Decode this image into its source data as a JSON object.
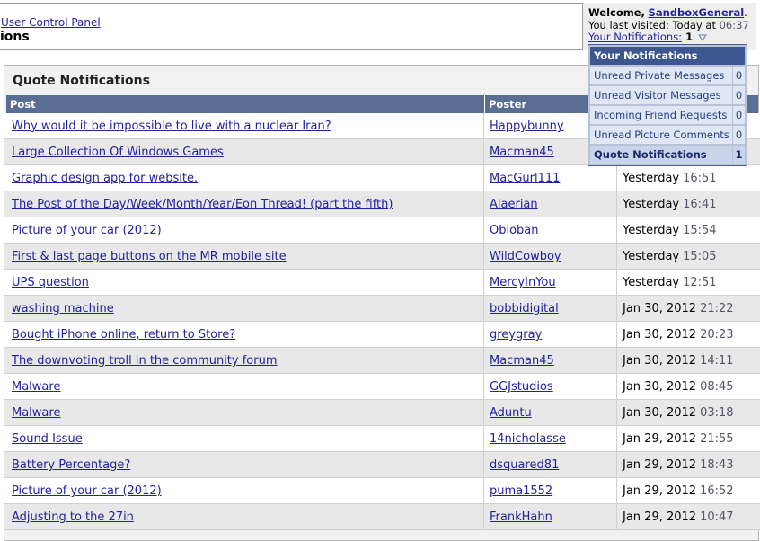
{
  "breadcrumb": "User Control Panel",
  "page_title": "ions",
  "welcome": {
    "label": "Welcome,",
    "username": "SandboxGeneral",
    "period": ".",
    "last_visited_label": "You last visited: Today at",
    "last_visited_time": "06:37",
    "notifications_label": "Your Notifications:",
    "notifications_count": "1"
  },
  "dropdown": {
    "title": "Your Notifications",
    "items": [
      {
        "label": "Unread Private Messages",
        "count": "0"
      },
      {
        "label": "Unread Visitor Messages",
        "count": "0"
      },
      {
        "label": "Incoming Friend Requests",
        "count": "0"
      },
      {
        "label": "Unread Picture Comments",
        "count": "0"
      },
      {
        "label": "Quote Notifications",
        "count": "1"
      }
    ]
  },
  "main": {
    "title": "Quote Notifications",
    "columns": {
      "post": "Post",
      "poster": "Poster",
      "date": ""
    },
    "rows": [
      {
        "post": "Why would it be impossible to live with a nuclear Iran?",
        "poster": "Happybunny",
        "date": "",
        "time": ""
      },
      {
        "post": "Large Collection Of Windows Games",
        "poster": "Macman45",
        "date": "",
        "time": ""
      },
      {
        "post": "Graphic design app for website.",
        "poster": "MacGurl111",
        "date": "Yesterday",
        "time": "16:51"
      },
      {
        "post": "The Post of the Day/Week/Month/Year/Eon Thread! (part the fifth)",
        "poster": "Alaerian",
        "date": "Yesterday",
        "time": "16:41"
      },
      {
        "post": "Picture of your car (2012)",
        "poster": "Obioban",
        "date": "Yesterday",
        "time": "15:54"
      },
      {
        "post": "First & last page buttons on the MR mobile site",
        "poster": "WildCowboy",
        "date": "Yesterday",
        "time": "15:05"
      },
      {
        "post": "UPS question",
        "poster": "MercyInYou",
        "date": "Yesterday",
        "time": "12:51"
      },
      {
        "post": "washing machine",
        "poster": "bobbidigital",
        "date": "Jan 30, 2012",
        "time": "21:22"
      },
      {
        "post": "Bought iPhone online, return to Store?",
        "poster": "greygray",
        "date": "Jan 30, 2012",
        "time": "20:23"
      },
      {
        "post": "The downvoting troll in the community forum",
        "poster": "Macman45",
        "date": "Jan 30, 2012",
        "time": "14:11"
      },
      {
        "post": "Malware",
        "poster": "GGJstudios",
        "date": "Jan 30, 2012",
        "time": "08:45"
      },
      {
        "post": "Malware",
        "poster": "Aduntu",
        "date": "Jan 30, 2012",
        "time": "03:18"
      },
      {
        "post": "Sound Issue",
        "poster": "14nicholasse",
        "date": "Jan 29, 2012",
        "time": "21:55"
      },
      {
        "post": "Battery Percentage?",
        "poster": "dsquared81",
        "date": "Jan 29, 2012",
        "time": "18:43"
      },
      {
        "post": "Picture of your car (2012)",
        "poster": "puma1552",
        "date": "Jan 29, 2012",
        "time": "16:52"
      },
      {
        "post": "Adjusting to the 27in",
        "poster": "FrankHahn",
        "date": "Jan 29, 2012",
        "time": "10:47"
      }
    ]
  },
  "colors": {
    "header_bg": "#5a6e94",
    "link": "#22229c",
    "dropdown_header": "#3e5690"
  },
  "icons": {
    "notifications_caret": "chevron-down-icon"
  }
}
